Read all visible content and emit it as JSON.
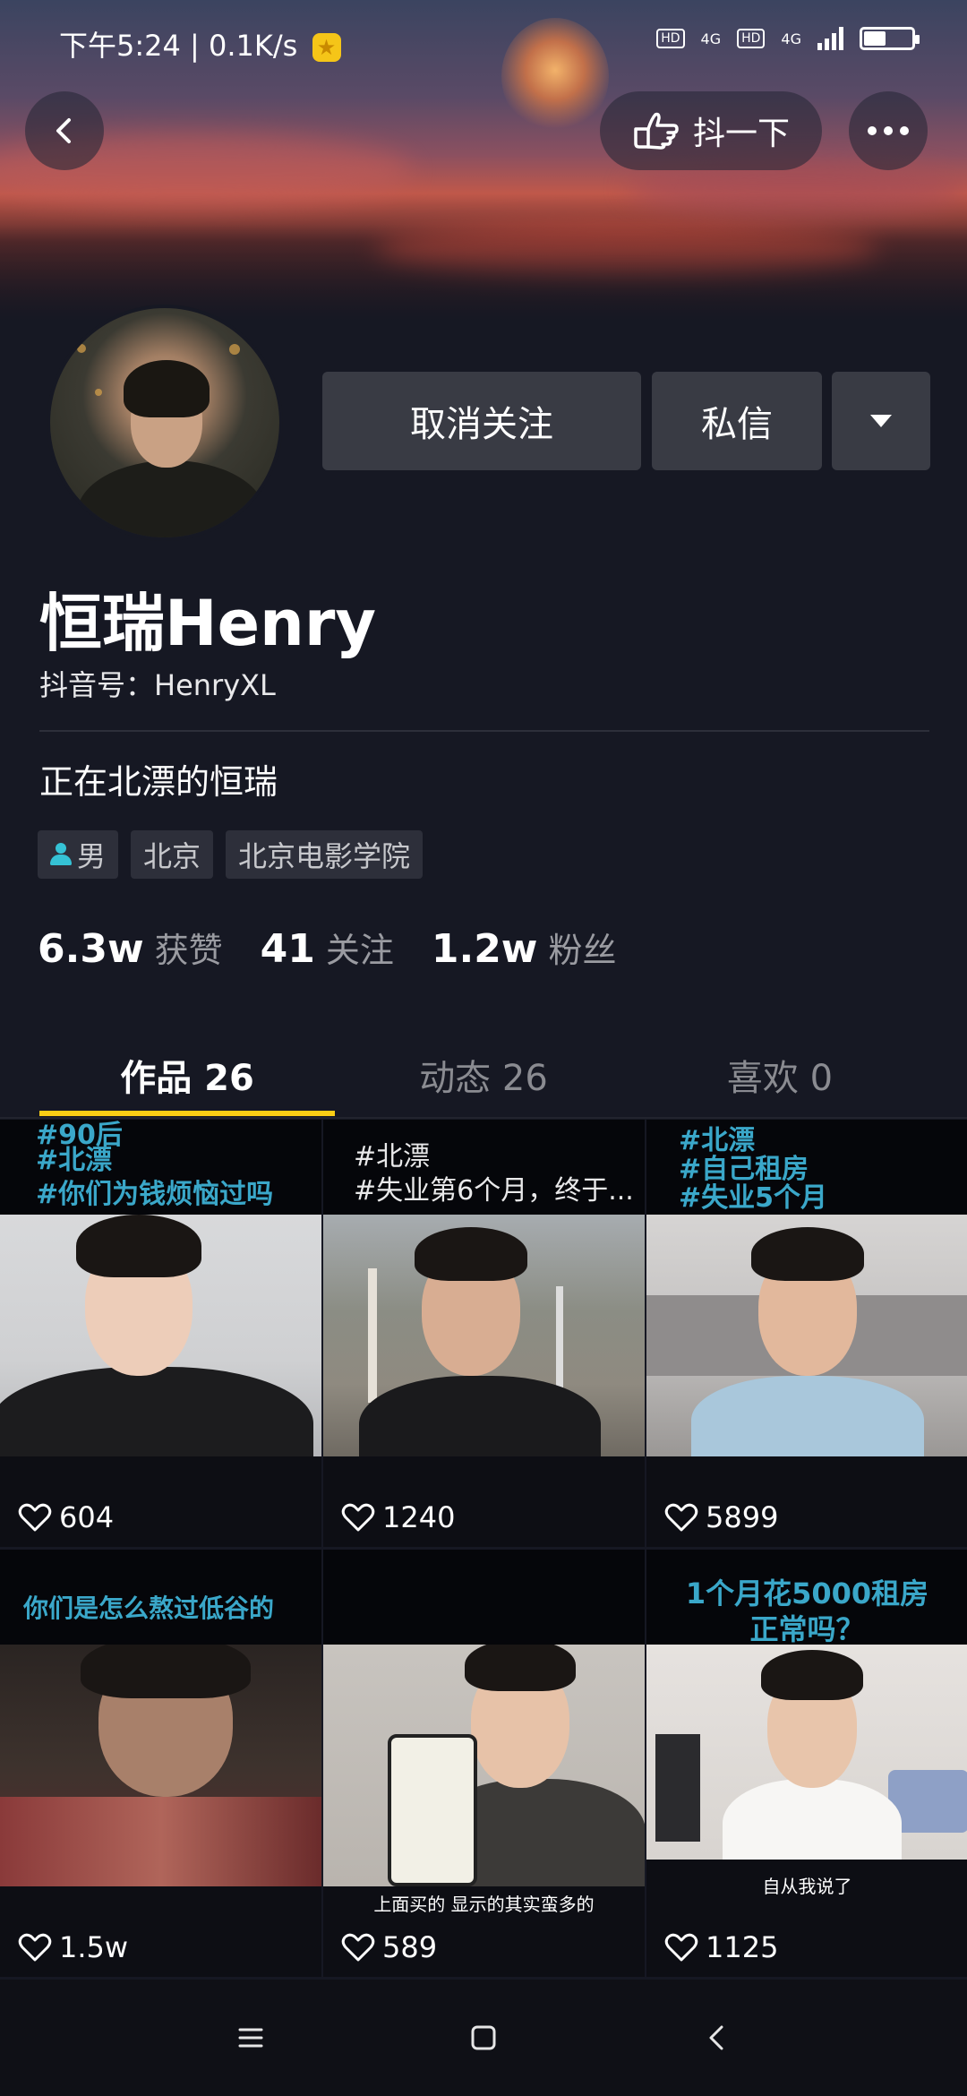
{
  "status_bar": {
    "time": "下午5:24 | 0.1K/s",
    "hd1": "HD",
    "net1": "4G",
    "hd2": "HD",
    "net2": "4G"
  },
  "header": {
    "shake_label": "抖一下"
  },
  "profile": {
    "name": "恒瑞Henry",
    "douyin_id": "抖音号：HenryXL",
    "bio": "正在北漂的恒瑞",
    "tags": {
      "gender": "男",
      "city": "北京",
      "school": "北京电影学院"
    },
    "stats": {
      "likes_num": "6.3w",
      "likes_label": "获赞",
      "following_num": "41",
      "following_label": "关注",
      "followers_num": "1.2w",
      "followers_label": "粉丝"
    }
  },
  "actions": {
    "unfollow": "取消关注",
    "message": "私信"
  },
  "tabs": {
    "works": "作品 26",
    "moments": "动态 26",
    "likes": "喜欢 0"
  },
  "videos": [
    {
      "caption": [
        "#90后",
        "#北漂",
        "#你们为钱烦恼过吗"
      ],
      "likes": "604"
    },
    {
      "caption": [
        "#北漂",
        "#失业第6个月，终于..."
      ],
      "likes": "1240"
    },
    {
      "caption": [
        "#北漂",
        "#自己租房",
        "#失业5个月"
      ],
      "likes": "5899"
    },
    {
      "caption": [
        "你们是怎么熬过低谷的"
      ],
      "likes": "1.5w"
    },
    {
      "caption": [],
      "subtitle": "上面买的 显示的其实蛮多的",
      "likes": "589"
    },
    {
      "caption": [
        "1个月花5000租房",
        "正常吗？"
      ],
      "subtitle": "自从我说了",
      "likes": "1125"
    }
  ],
  "colors": {
    "background": "#161823",
    "button": "#393b44",
    "tab_underline": "#face15",
    "caption": "#3aa7c9",
    "gender_icon": "#35c2d5"
  }
}
